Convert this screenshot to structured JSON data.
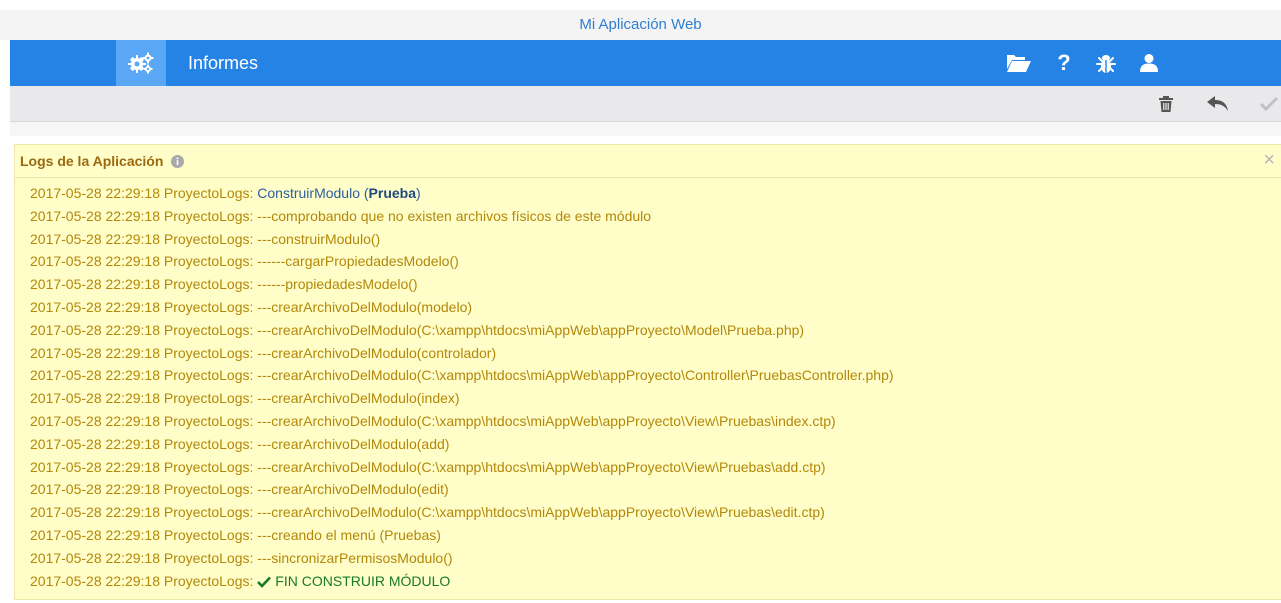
{
  "app": {
    "title": "Mi Aplicación Web"
  },
  "nav": {
    "section_title": "Informes",
    "home_icon": "gears-icon",
    "icons": [
      "folder-open-icon",
      "help-icon",
      "bug-icon",
      "user-icon"
    ],
    "help_glyph": "?"
  },
  "toolbar": {
    "actions": [
      "trash-icon",
      "undo-icon",
      "check-icon"
    ]
  },
  "panel": {
    "title": "Logs de la Aplicación",
    "close_glyph": "×"
  },
  "logs": {
    "first": {
      "prefix": "2017-05-28 22:29:18 ProyectoLogs: ",
      "text": "ConstruirModulo (",
      "bold": "Prueba",
      "suffix": ")"
    },
    "lines": [
      {
        "prefix": "2017-05-28 22:29:18 ProyectoLogs: ",
        "text": "---comprobando que no existen archivos físicos de este módulo"
      },
      {
        "prefix": "2017-05-28 22:29:18 ProyectoLogs: ",
        "text": "---construirModulo()"
      },
      {
        "prefix": "2017-05-28 22:29:18 ProyectoLogs: ",
        "text": "------cargarPropiedadesModelo()"
      },
      {
        "prefix": "2017-05-28 22:29:18 ProyectoLogs: ",
        "text": "------propiedadesModelo()"
      },
      {
        "prefix": "2017-05-28 22:29:18 ProyectoLogs: ",
        "text": "---crearArchivoDelModulo(modelo)"
      },
      {
        "prefix": "2017-05-28 22:29:18 ProyectoLogs: ",
        "text": "---crearArchivoDelModulo(C:\\xampp\\htdocs\\miAppWeb\\appProyecto\\Model\\Prueba.php)"
      },
      {
        "prefix": "2017-05-28 22:29:18 ProyectoLogs: ",
        "text": "---crearArchivoDelModulo(controlador)"
      },
      {
        "prefix": "2017-05-28 22:29:18 ProyectoLogs: ",
        "text": "---crearArchivoDelModulo(C:\\xampp\\htdocs\\miAppWeb\\appProyecto\\Controller\\PruebasController.php)"
      },
      {
        "prefix": "2017-05-28 22:29:18 ProyectoLogs: ",
        "text": "---crearArchivoDelModulo(index)"
      },
      {
        "prefix": "2017-05-28 22:29:18 ProyectoLogs: ",
        "text": "---crearArchivoDelModulo(C:\\xampp\\htdocs\\miAppWeb\\appProyecto\\View\\Pruebas\\index.ctp)"
      },
      {
        "prefix": "2017-05-28 22:29:18 ProyectoLogs: ",
        "text": "---crearArchivoDelModulo(add)"
      },
      {
        "prefix": "2017-05-28 22:29:18 ProyectoLogs: ",
        "text": "---crearArchivoDelModulo(C:\\xampp\\htdocs\\miAppWeb\\appProyecto\\View\\Pruebas\\add.ctp)"
      },
      {
        "prefix": "2017-05-28 22:29:18 ProyectoLogs: ",
        "text": "---crearArchivoDelModulo(edit)"
      },
      {
        "prefix": "2017-05-28 22:29:18 ProyectoLogs: ",
        "text": "---crearArchivoDelModulo(C:\\xampp\\htdocs\\miAppWeb\\appProyecto\\View\\Pruebas\\edit.ctp)"
      },
      {
        "prefix": "2017-05-28 22:29:18 ProyectoLogs: ",
        "text": "---creando el menú (Pruebas)"
      },
      {
        "prefix": "2017-05-28 22:29:18 ProyectoLogs: ",
        "text": "---sincronizarPermisosModulo()"
      }
    ],
    "last": {
      "prefix": "2017-05-28 22:29:18 ProyectoLogs: ",
      "text": "FIN CONSTRUIR MÓDULO",
      "icon": "check-icon"
    }
  },
  "colors": {
    "nav_bg": "#2583e6",
    "nav_active": "#5aa8f5",
    "log_bg": "#fffdc8",
    "log_text": "#b3880a",
    "success": "#167a2b"
  }
}
